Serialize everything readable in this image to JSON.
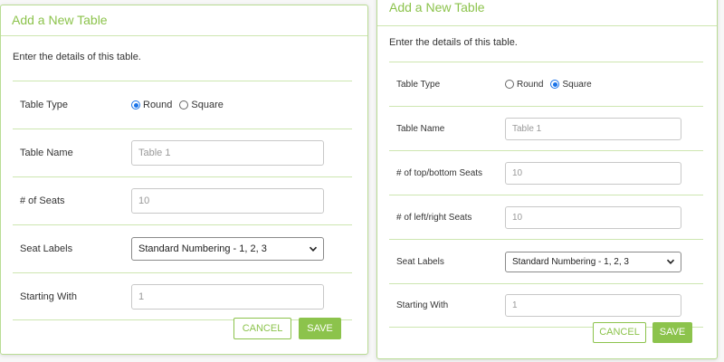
{
  "dialog_round": {
    "title": "Add a New Table",
    "intro": "Enter the details of this table.",
    "table_type": {
      "label": "Table Type",
      "options": [
        "Round",
        "Square"
      ],
      "selected": "Round"
    },
    "table_name": {
      "label": "Table Name",
      "placeholder": "Table 1"
    },
    "seats": {
      "label": "# of Seats",
      "placeholder": "10"
    },
    "seat_labels": {
      "label": "Seat Labels",
      "selected": "Standard Numbering - 1, 2, 3"
    },
    "starting_with": {
      "label": "Starting With",
      "placeholder": "1"
    },
    "cancel_label": "CANCEL",
    "save_label": "SAVE"
  },
  "dialog_square": {
    "title": "Add a New Table",
    "intro": "Enter the details of this table.",
    "table_type": {
      "label": "Table Type",
      "options": [
        "Round",
        "Square"
      ],
      "selected": "Square"
    },
    "table_name": {
      "label": "Table Name",
      "placeholder": "Table 1"
    },
    "top_bottom_seats": {
      "label": "# of top/bottom Seats",
      "placeholder": "10"
    },
    "left_right_seats": {
      "label": "# of left/right Seats",
      "placeholder": "10"
    },
    "seat_labels": {
      "label": "Seat Labels",
      "selected": "Standard Numbering - 1, 2, 3"
    },
    "starting_with": {
      "label": "Starting With",
      "placeholder": "1"
    },
    "cancel_label": "CANCEL",
    "save_label": "SAVE"
  },
  "colors": {
    "accent": "#8cc34c",
    "divider": "#cde6b0",
    "radio_selected": "#1a73e8"
  },
  "icons": {
    "select_arrow": "chevron-down-icon"
  }
}
